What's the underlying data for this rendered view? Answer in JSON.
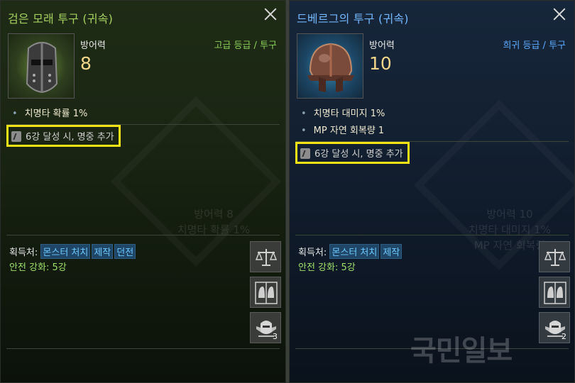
{
  "left": {
    "title": "검은 모래 투구 (귀속)",
    "grade": "고급 등급 / 투구",
    "stat_label": "방어력",
    "stat_value": "8",
    "options": [
      "치명타 확률 1%"
    ],
    "condition": "6강 달성 시, 명중 추가",
    "ghost_lines": [
      "방어력 8",
      "치명타 확률 1%"
    ],
    "acq_label": "획득처:",
    "acq_tags": [
      "몬스터 처치",
      "제작",
      "던전"
    ],
    "safe_enhance": "안전 강화: 5강",
    "count_badge": "3",
    "title_color": "#a6d060",
    "grade_color": "#8bcf5a"
  },
  "right": {
    "title": "드베르그의 투구 (귀속)",
    "grade": "희귀 등급 / 투구",
    "stat_label": "방어력",
    "stat_value": "10",
    "options": [
      "치명타 대미지 1%",
      "MP 자연 회복량 1"
    ],
    "condition": "6강 달성 시, 명중 추가",
    "ghost_lines": [
      "방어력 10",
      "치명타 대미지 1%",
      "MP 자연 회복량"
    ],
    "acq_label": "획득처:",
    "acq_tags": [
      "몬스터 처치",
      "제작"
    ],
    "safe_enhance": "안전 강화: 5강",
    "count_badge": "2",
    "title_color": "#73b8ff",
    "grade_color": "#5eaaff"
  },
  "icons": {
    "close": "close-icon",
    "scale": "scale-icon",
    "compare": "compare-helmet-icon",
    "crest": "crest-helmet-icon"
  },
  "watermark": "국민일보"
}
